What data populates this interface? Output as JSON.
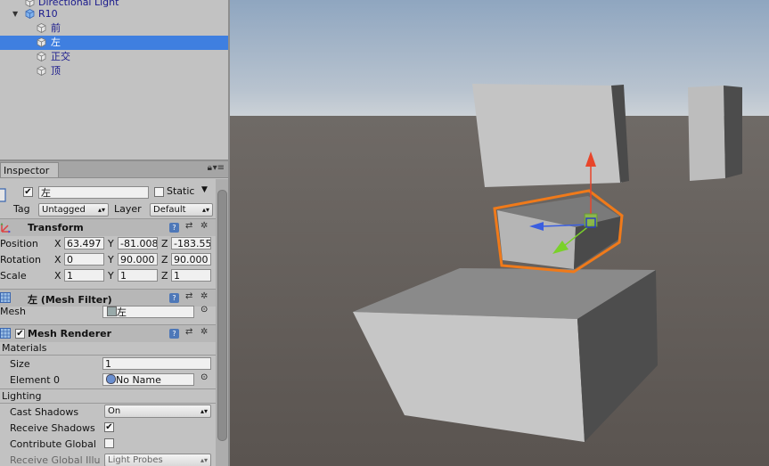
{
  "hierarchy": {
    "items": [
      {
        "label": "Directional Light",
        "level": 1
      },
      {
        "label": "R10",
        "level": 0,
        "expanded": true
      },
      {
        "label": "前",
        "level": 1
      },
      {
        "label": "左",
        "level": 1,
        "selected": true
      },
      {
        "label": "正交",
        "level": 1
      },
      {
        "label": "顶",
        "level": 1
      }
    ]
  },
  "inspector": {
    "tab_label": "Inspector",
    "object": {
      "name": "左",
      "active": true,
      "static_label": "Static",
      "tag_label": "Tag",
      "tag_value": "Untagged",
      "layer_label": "Layer",
      "layer_value": "Default"
    },
    "transform": {
      "title": "Transform",
      "position_label": "Position",
      "rotation_label": "Rotation",
      "scale_label": "Scale",
      "axis_x": "X",
      "axis_y": "Y",
      "axis_z": "Z",
      "position": {
        "x": "63.497",
        "y": "-81.008",
        "z": "-183.55"
      },
      "rotation": {
        "x": "0",
        "y": "90.000",
        "z": "90.000"
      },
      "scale": {
        "x": "1",
        "y": "1",
        "z": "1"
      }
    },
    "mesh_filter": {
      "title": "左 (Mesh Filter)",
      "mesh_label": "Mesh",
      "mesh_value": "左"
    },
    "mesh_renderer": {
      "title": "Mesh Renderer",
      "enabled": true,
      "materials_label": "Materials",
      "size_label": "Size",
      "size_value": "1",
      "element0_label": "Element 0",
      "element0_value": "No Name",
      "lighting_label": "Lighting",
      "cast_shadows_label": "Cast Shadows",
      "cast_shadows_value": "On",
      "receive_shadows_label": "Receive Shadows",
      "receive_shadows_checked": true,
      "contribute_global_label": "Contribute Global",
      "contribute_global_checked": false,
      "receive_gi_label": "Receive Global Illu",
      "receive_gi_value": "Light Probes"
    }
  },
  "colors": {
    "selection": "#3f7fe0",
    "panel_bg": "#c2c2c2",
    "selection_outline": "#f07a1a",
    "gizmo_y": "#e8452a",
    "gizmo_x": "#3a5ee0",
    "gizmo_z": "#7ad12a"
  }
}
